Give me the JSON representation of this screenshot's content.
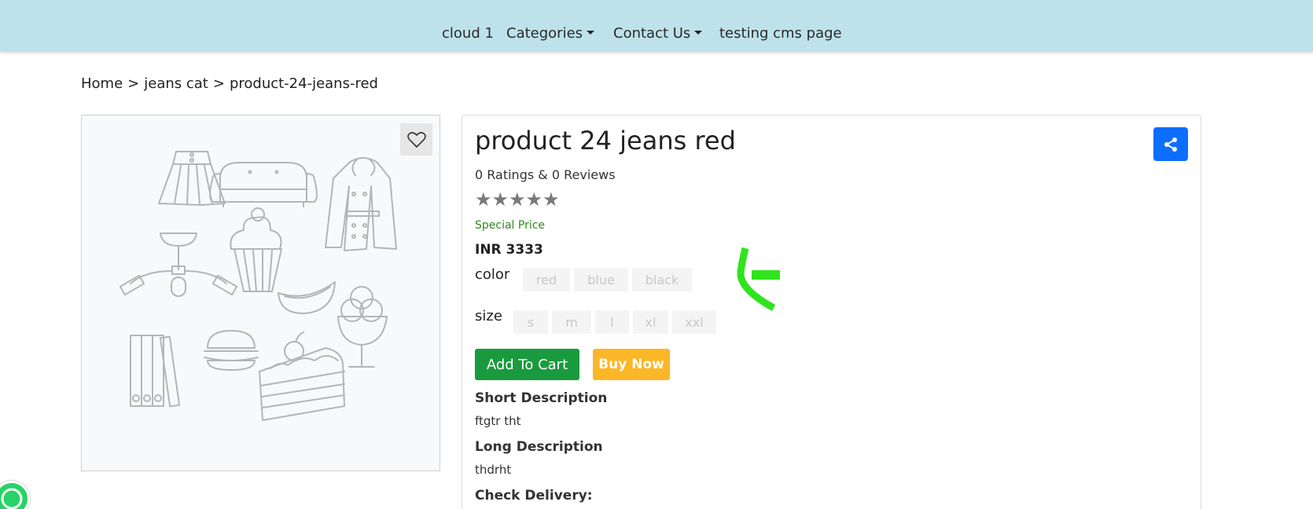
{
  "nav": {
    "items": [
      {
        "label": "cloud 1",
        "dropdown": false
      },
      {
        "label": "Categories",
        "dropdown": true
      },
      {
        "label": "Contact Us",
        "dropdown": true
      },
      {
        "label": "testing cms page",
        "dropdown": false
      }
    ],
    "bg_color": "#bde2ea"
  },
  "breadcrumb": {
    "items": [
      "Home",
      "jeans cat",
      "product-24-jeans-red"
    ],
    "separator": ">"
  },
  "product": {
    "title": "product 24 jeans red",
    "ratings_text": "0 Ratings & 0 Reviews",
    "stars": "★★★★★",
    "rating_value": 0,
    "special_label": "Special Price",
    "price": "INR 3333",
    "color_label": "color",
    "colors": [
      "red",
      "blue",
      "black"
    ],
    "size_label": "size",
    "sizes": [
      "s",
      "m",
      "l",
      "xl",
      "xxl"
    ],
    "add_to_cart": "Add To Cart",
    "buy_now": "Buy Now",
    "short_desc_title": "Short Description",
    "short_desc": "ftgtr tht",
    "long_desc_title": "Long Description",
    "long_desc": "thdrht",
    "delivery_title": "Check Delivery:"
  },
  "icons": {
    "wishlist": "heart-icon",
    "share": "share-icon",
    "whatsapp": "whatsapp-icon"
  },
  "colors": {
    "accent_blue": "#0d6efd",
    "cart_green": "#1a9a3f",
    "buy_yellow": "#fbb727",
    "special_green": "#2e8b1e"
  }
}
